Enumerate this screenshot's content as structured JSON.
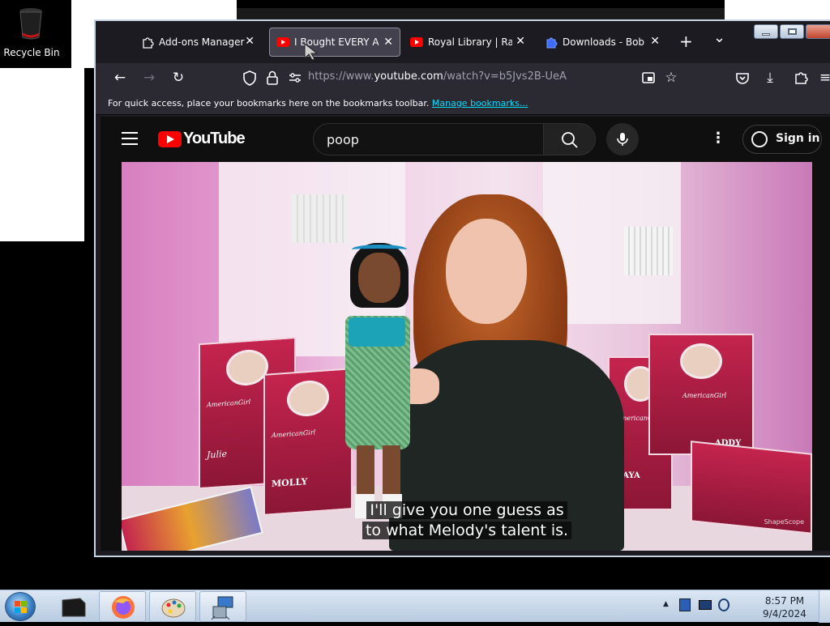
{
  "desktop": {
    "recycle_bin_label": "Recycle Bin"
  },
  "browser": {
    "tabs": [
      {
        "label": "Add-ons Manager",
        "icon": "puzzle-icon",
        "active": false
      },
      {
        "label": "I Bought EVERY American Girl",
        "icon": "youtube-icon",
        "active": true
      },
      {
        "label": "Royal Library | Rainbow",
        "icon": "youtube-icon",
        "active": false
      },
      {
        "label": "Downloads - Bob Pease",
        "icon": "puzzle-icon",
        "active": false
      }
    ],
    "new_tab_glyph": "+",
    "tab_list_glyph": "⌄",
    "url_prefix": "https://www.",
    "url_host": "youtube.com",
    "url_path": "/watch?v=b5Jvs2B-UeA",
    "bookmarks_text": "For quick access, place your bookmarks here on the bookmarks toolbar.",
    "bookmarks_link": "Manage bookmarks..."
  },
  "youtube": {
    "logo_text": "YouTube",
    "search_value": "poop",
    "sign_in_label": "Sign in",
    "caption_line1": "I'll give you one guess as",
    "caption_line2": "to what Melody's talent is.",
    "box_brand": "AmericanGirl",
    "box_names": [
      "Julie",
      "MOLLY",
      "KAYA",
      "ADDY"
    ],
    "watermark": "ShapeScope"
  },
  "taskbar": {
    "time": "8:57 PM",
    "date": "9/4/2024",
    "tray_expand_glyph": "▲"
  },
  "colors": {
    "accent_red": "#ff0000",
    "firefox_dark": "#1c1b22",
    "link_cyan": "#00ddff"
  }
}
